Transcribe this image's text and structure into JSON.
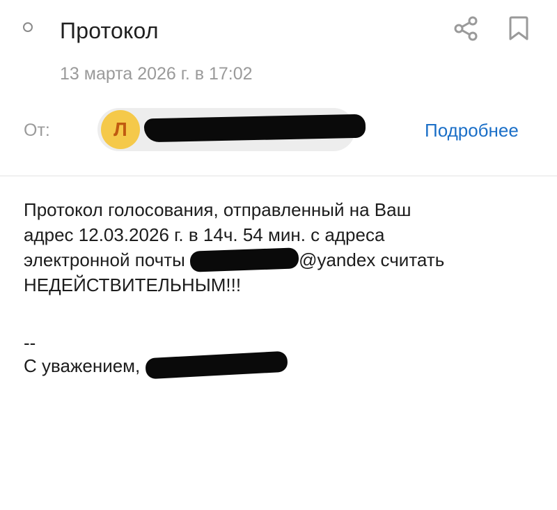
{
  "header": {
    "subject": "Протокол",
    "date": "13 марта 2026 г. в 17:02",
    "status_icon": "unread-status-circle-icon",
    "share_icon": "share-icon",
    "bookmark_icon": "bookmark-icon"
  },
  "sender": {
    "from_label": "От:",
    "avatar_letter": "Л",
    "avatar_color": "#f5c94a",
    "avatar_text_color": "#c05a10",
    "details_link": "Подробнее",
    "link_color": "#1b6fc7"
  },
  "message": {
    "line1": "Протокол голосования, отправленный на Ваш",
    "line2": "адрес 12.03.2026 г. в 14ч. 54 мин. с адреса",
    "line3_prefix": "электронной почты ",
    "line3_suffix": "@yandex считать",
    "line4": "НЕДЕЙСТВИТЕЛЬНЫМ!!!",
    "signature_separator": "--",
    "signature_prefix": "С уважением, "
  }
}
